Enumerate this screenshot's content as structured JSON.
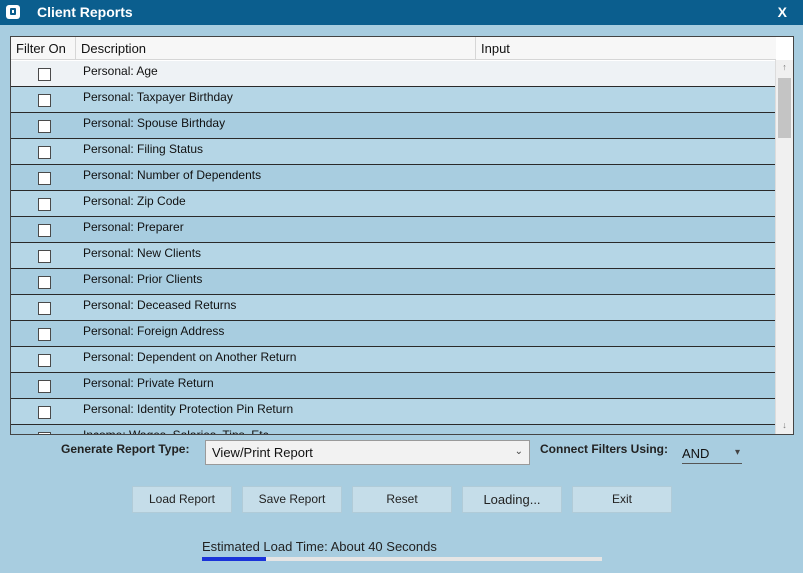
{
  "window": {
    "title": "Client Reports",
    "close_label": "X"
  },
  "grid": {
    "columns": [
      "Filter On",
      "Description",
      "Input"
    ],
    "rows": [
      {
        "description": "Personal: Age",
        "checked": false
      },
      {
        "description": "Personal: Taxpayer Birthday",
        "checked": false
      },
      {
        "description": "Personal: Spouse Birthday",
        "checked": false
      },
      {
        "description": "Personal: Filing Status",
        "checked": false
      },
      {
        "description": "Personal: Number of Dependents",
        "checked": false
      },
      {
        "description": "Personal: Zip Code",
        "checked": false
      },
      {
        "description": "Personal: Preparer",
        "checked": false
      },
      {
        "description": "Personal: New Clients",
        "checked": false
      },
      {
        "description": "Personal: Prior Clients",
        "checked": false
      },
      {
        "description": "Personal: Deceased Returns",
        "checked": false
      },
      {
        "description": "Personal: Foreign Address",
        "checked": false
      },
      {
        "description": "Personal: Dependent on Another Return",
        "checked": false
      },
      {
        "description": "Personal: Private Return",
        "checked": false
      },
      {
        "description": "Personal: Identity Protection Pin Return",
        "checked": false
      },
      {
        "description": "Income: Wages, Salaries, Tips, Etc.",
        "checked": false
      }
    ]
  },
  "report_type": {
    "label": "Generate Report Type:",
    "value": "View/Print Report"
  },
  "connect_filters": {
    "label": "Connect Filters Using:",
    "value": "AND"
  },
  "buttons": {
    "load": "Load Report",
    "save": "Save Report",
    "reset": "Reset",
    "loading": "Loading...",
    "exit": "Exit"
  },
  "status": {
    "estimated": "Estimated Load Time: About 40 Seconds",
    "progress_fraction": 0.16
  }
}
